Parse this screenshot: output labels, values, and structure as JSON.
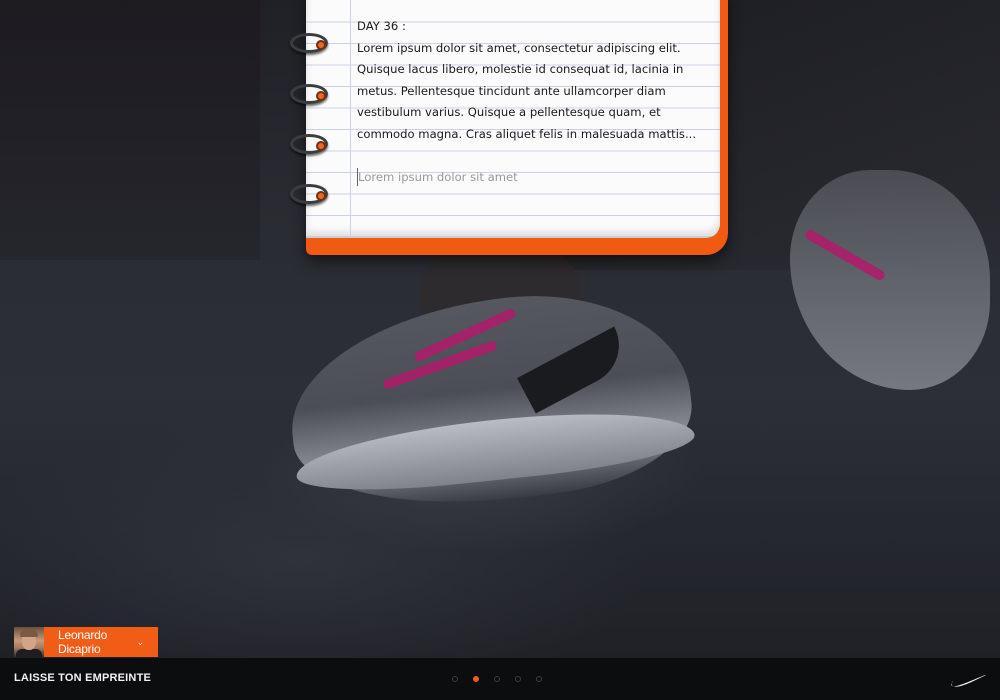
{
  "notebook": {
    "day": "DAY 36 :",
    "entry": "Lorem ipsum dolor sit amet, consectetur adipiscing elit. Quisque lacus libero, molestie id consequat id, lacinia in metus. Pellentesque tincidunt ante ullamcorper diam vestibulum varius. Quisque a pellentesque quam, et commodo magna. Cras aliquet felis in malesuada mattis...",
    "new_entry_placeholder": "Lorem ipsum dolor sit amet",
    "new_entry_value": ""
  },
  "user": {
    "name": "Leonardo Dicaprio",
    "chevron": "⌄"
  },
  "footer": {
    "brand": "LAISSE TON EMPREINTE",
    "pagination": {
      "count": 5,
      "active_index": 1
    },
    "logo_icon": "nike-swoosh-icon"
  },
  "colors": {
    "accent": "#f15d17",
    "footer_bg": "#0c0d0f",
    "paper": "#fbfbfb"
  }
}
